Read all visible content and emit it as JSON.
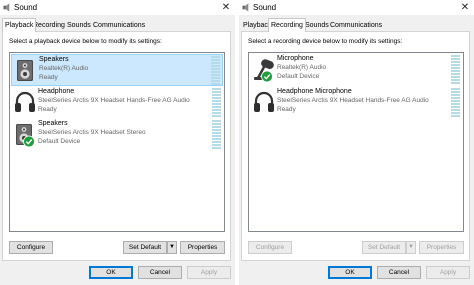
{
  "left": {
    "title": "Sound",
    "close_glyph": "✕",
    "tabs": [
      "Playback",
      "Recording",
      "Sounds",
      "Communications"
    ],
    "active_tab": "Playback",
    "instruction": "Select a playback device below to modify its settings:",
    "devices": [
      {
        "name": "Speakers",
        "description": "Realtek(R) Audio",
        "status": "Ready",
        "icon": "speaker-icon",
        "selected": true,
        "default": false
      },
      {
        "name": "Headphone",
        "description": "SteelSeries Arctis 9X Headset Hands-Free AG Audio",
        "status": "Ready",
        "icon": "headphone-icon",
        "selected": false,
        "default": false
      },
      {
        "name": "Speakers",
        "description": "SteelSeries Arctis 9X Headset Stereo",
        "status": "Default Device",
        "icon": "speaker-icon",
        "selected": false,
        "default": true
      }
    ],
    "buttons": {
      "configure": "Configure",
      "set_default": "Set Default",
      "properties": "Properties",
      "ok": "OK",
      "cancel": "Cancel",
      "apply": "Apply",
      "arrow": "▼"
    }
  },
  "right": {
    "title": "Sound",
    "close_glyph": "✕",
    "tabs": [
      "Playback",
      "Recording",
      "Sounds",
      "Communications"
    ],
    "active_tab": "Recording",
    "instruction": "Select a recording device below to modify its settings:",
    "devices": [
      {
        "name": "Microphone",
        "description": "Realtek(R) Audio",
        "status": "Default Device",
        "icon": "microphone-icon",
        "selected": false,
        "default": true
      },
      {
        "name": "Headphone Microphone",
        "description": "SteelSeries Arctis 9X Headset Hands-Free AG Audio",
        "status": "Ready",
        "icon": "headphone-icon",
        "selected": false,
        "default": false
      }
    ],
    "buttons": {
      "configure": "Configure",
      "set_default": "Set Default",
      "properties": "Properties",
      "ok": "OK",
      "cancel": "Cancel",
      "apply": "Apply",
      "arrow": "▼"
    }
  },
  "colors": {
    "selection_bg": "#cce8ff",
    "selection_border": "#99d1ff",
    "default_check": "#1e9e3c",
    "level_meter": "#b5dbe8",
    "accent": "#0078d7"
  }
}
